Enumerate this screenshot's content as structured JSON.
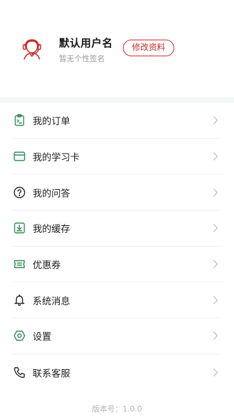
{
  "profile": {
    "username": "默认用户名",
    "signature": "暂无个性签名",
    "edit_label": "修改资料",
    "avatar_icon": "customer-service-avatar-icon",
    "accent_color": "#c9302c"
  },
  "menu": {
    "items": [
      {
        "label": "我的订单",
        "icon": "order-clipboard-icon"
      },
      {
        "label": "我的学习卡",
        "icon": "card-icon"
      },
      {
        "label": "我的问答",
        "icon": "question-icon"
      },
      {
        "label": "我的缓存",
        "icon": "download-icon"
      },
      {
        "label": "优惠券",
        "icon": "coupon-icon"
      },
      {
        "label": "系统消息",
        "icon": "bell-icon"
      },
      {
        "label": "设置",
        "icon": "settings-hex-icon"
      },
      {
        "label": "联系客服",
        "icon": "phone-icon"
      }
    ],
    "icon_color": "#2e8b57"
  },
  "footer": {
    "version": "版本号：1.0.0"
  }
}
